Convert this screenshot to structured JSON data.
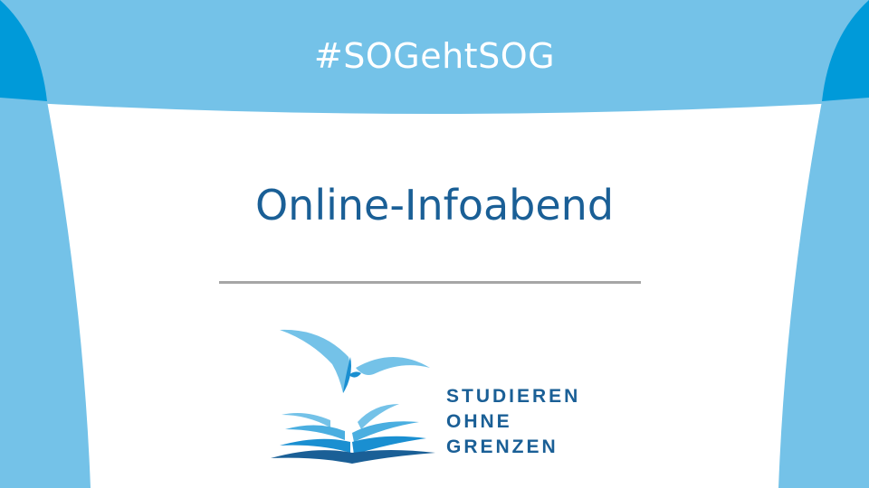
{
  "header": {
    "hashtag": "#SOGehtSOG"
  },
  "main": {
    "title": "Online-Infoabend"
  },
  "logo": {
    "line1": "STUDIEREN",
    "line2": "OHNE",
    "line3": "GRENZEN",
    "icon": "book-with-birds-icon"
  },
  "colors": {
    "light_blue": "#74c2e8",
    "accent_blue": "#009ad9",
    "dark_blue": "#1a5f96",
    "divider_gray": "#a6a6a6",
    "background": "#ffffff"
  }
}
